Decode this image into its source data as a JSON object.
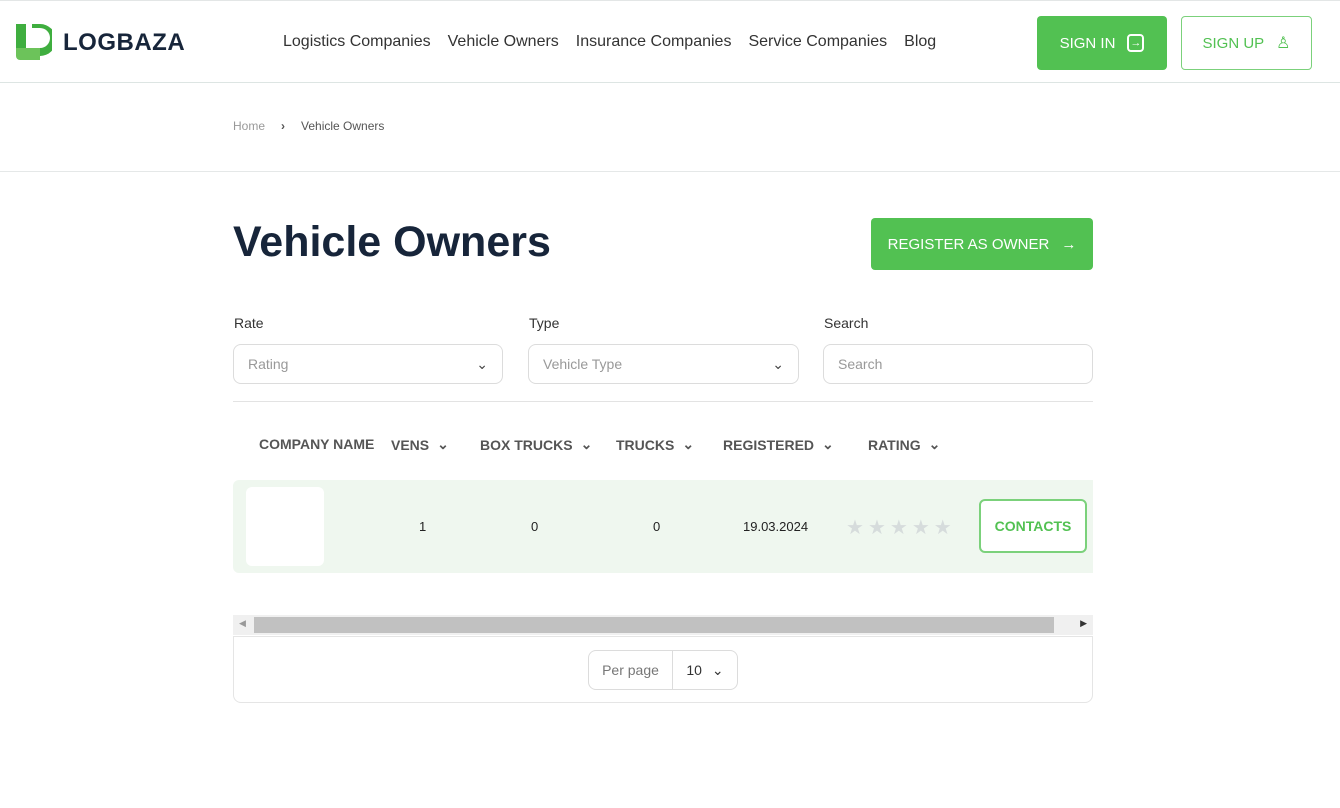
{
  "header": {
    "logo": "LOGBAZA",
    "nav": [
      "Logistics Companies",
      "Vehicle Owners",
      "Insurance Companies",
      "Service Companies",
      "Blog"
    ],
    "sign_in": "SIGN IN",
    "sign_up": "SIGN UP"
  },
  "breadcrumb": {
    "home": "Home",
    "current": "Vehicle Owners"
  },
  "page": {
    "title": "Vehicle Owners",
    "register": "REGISTER AS OWNER"
  },
  "filters": {
    "rate_label": "Rate",
    "rate_placeholder": "Rating",
    "type_label": "Type",
    "type_placeholder": "Vehicle Type",
    "search_label": "Search",
    "search_placeholder": "Search"
  },
  "table": {
    "headers": [
      "COMPANY NAME",
      "VENS",
      "BOX TRUCKS",
      "TRUCKS",
      "REGISTERED",
      "RATING"
    ],
    "rows": [
      {
        "vens": "1",
        "box_trucks": "0",
        "trucks": "0",
        "registered": "19.03.2024",
        "rating": 0,
        "contacts": "CONTACTS"
      }
    ]
  },
  "pagination": {
    "per_page_label": "Per page",
    "per_page": "10"
  },
  "colors": {
    "accent": "#52c152",
    "row_bg": "#eff7ef",
    "title": "#17253a"
  }
}
